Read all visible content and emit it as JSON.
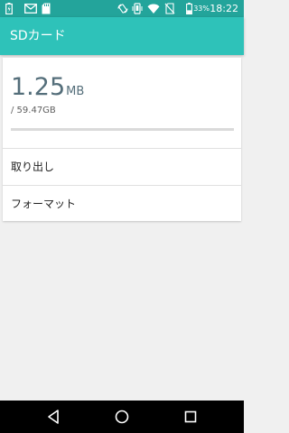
{
  "status_bar": {
    "battery_percent": "33%",
    "time": "18:22",
    "icons": [
      "battery-charging-icon",
      "mail-icon",
      "sd-card-icon",
      "rotate-icon",
      "vibrate-icon",
      "wifi-icon",
      "no-sim-icon",
      "battery-icon"
    ]
  },
  "toolbar": {
    "title": "SDカード"
  },
  "storage": {
    "used_value": "1.25",
    "used_unit": "MB",
    "total": "/ 59.47GB",
    "used_fraction": 2e-05
  },
  "menu": {
    "items": [
      {
        "label": "取り出し"
      },
      {
        "label": "フォーマット"
      }
    ]
  },
  "nav_bar": {
    "buttons": [
      "back-icon",
      "home-icon",
      "recents-icon"
    ]
  },
  "colors": {
    "status_bar": "#23a49b",
    "toolbar": "#2ec2b9",
    "background": "#f0f0f0",
    "accent": "#2ec2b9"
  }
}
